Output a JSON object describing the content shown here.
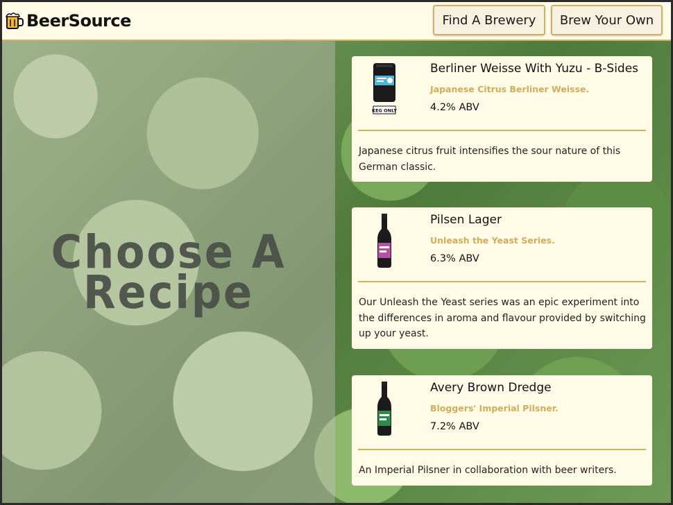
{
  "app": {
    "brand": "BeerSource",
    "brand_icon": "beer-mug-icon",
    "accent_color": "#d1ad5a",
    "background_color": "#fffbe6"
  },
  "nav": {
    "find_brewery": "Find A Brewery",
    "brew_your_own": "Brew Your Own"
  },
  "hero": {
    "title_line1": "Choose A",
    "title_line2": "Recipe"
  },
  "recipes": [
    {
      "name": "Berliner Weisse With Yuzu - B-Sides",
      "tagline": "Japanese Citrus Berliner Weisse.",
      "abv": "4.2% ABV",
      "description": "Japanese citrus fruit intensifies the sour nature of this German classic.",
      "image": "keg-icon",
      "image_label": "KEG ONLY"
    },
    {
      "name": "Pilsen Lager",
      "tagline": "Unleash the Yeast Series.",
      "abv": "6.3% ABV",
      "description": "Our Unleash the Yeast series was an epic experiment into the differences in aroma and flavour provided by switching up your yeast.",
      "image": "beer-bottle-icon"
    },
    {
      "name": "Avery Brown Dredge",
      "tagline": "Bloggers' Imperial Pilsner.",
      "abv": "7.2% ABV",
      "description": "An Imperial Pilsner in collaboration with beer writers.",
      "image": "beer-bottle-icon"
    }
  ]
}
